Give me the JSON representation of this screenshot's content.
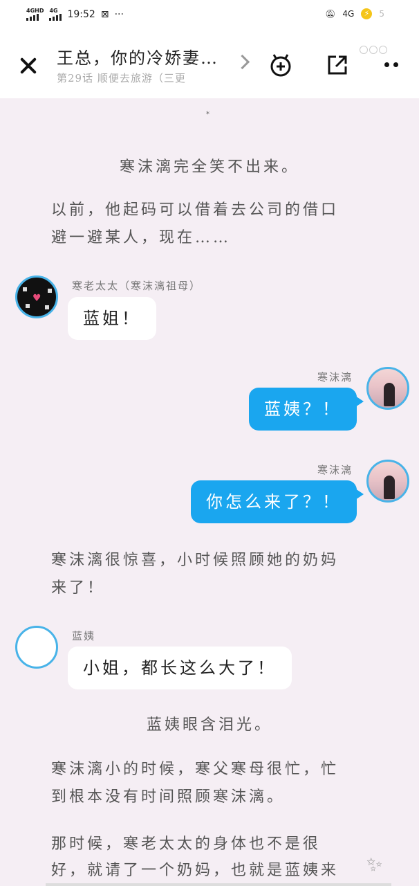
{
  "status_bar": {
    "signal1": "4GHD",
    "signal2": "4G",
    "time": "19:52",
    "network": "4G",
    "extra": "5"
  },
  "header": {
    "title": "王总，你的冷娇妻…",
    "subtitle": "第29话 顺便去旅游（三更",
    "icons": [
      "close-icon",
      "chevron-right-icon",
      "add-bookshelf-icon",
      "share-icon",
      "more-icon"
    ]
  },
  "content": {
    "marker": "*",
    "paragraph1": "寒沫漓完全笑不出来。",
    "paragraph2_line1": "以前，他起码可以借着去公司的借口",
    "paragraph2_line2": "避一避某人，现在……",
    "msg1": {
      "speaker": "寒老太太（寒沫漓祖母）",
      "text": "蓝姐！"
    },
    "msg2": {
      "speaker": "寒沫漓",
      "text": "蓝姨？！"
    },
    "msg3": {
      "speaker": "寒沫漓",
      "text": "你怎么来了？！"
    },
    "paragraph3_line1": "寒沫漓很惊喜，小时候照顾她的奶妈",
    "paragraph3_line2": "来了！",
    "msg4": {
      "speaker": "蓝姨",
      "text": "小姐，都长这么大了！"
    },
    "paragraph4": "蓝姨眼含泪光。",
    "paragraph5_line1": "寒沫漓小的时候，寒父寒母很忙，忙",
    "paragraph5_line2": "到根本没有时间照顾寒沫漓。",
    "paragraph6_line1": "那时候，寒老太太的身体也不是很",
    "paragraph6_line2": "好，就请了一个奶妈，也就是蓝姨来"
  },
  "colors": {
    "accent": "#1aa6ef",
    "background": "#f5eef4",
    "avatar_border": "#48b3e8"
  }
}
